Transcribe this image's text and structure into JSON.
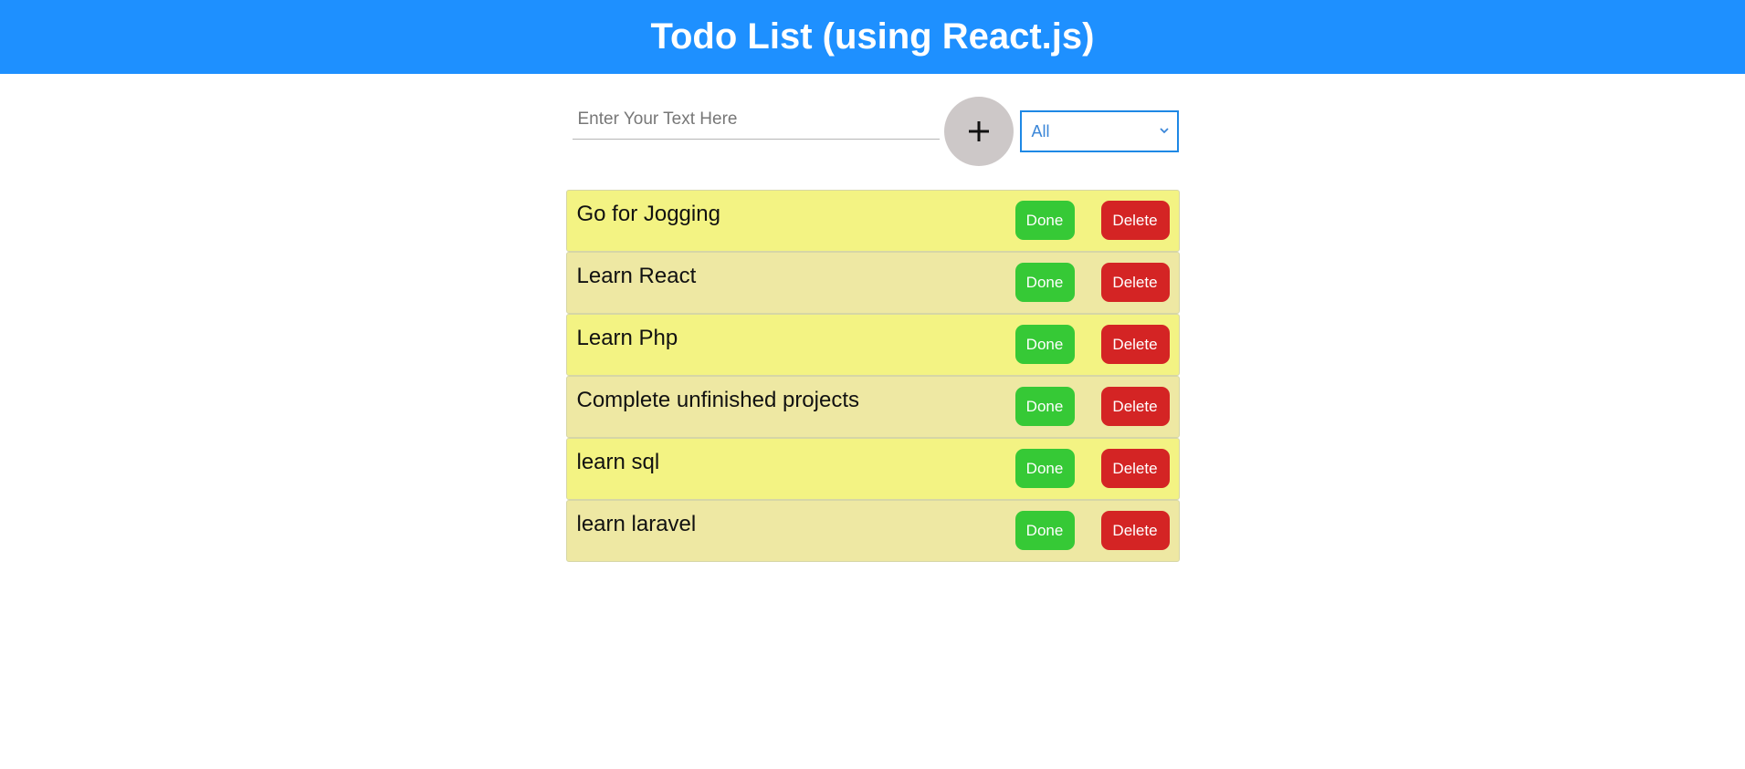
{
  "header": {
    "title": "Todo List (using React.js)"
  },
  "controls": {
    "input_placeholder": "Enter Your Text Here",
    "add_icon": "plus-icon",
    "filter_selected": "All"
  },
  "todos": [
    {
      "text": "Go for Jogging",
      "done_label": "Done",
      "delete_label": "Delete"
    },
    {
      "text": "Learn React",
      "done_label": "Done",
      "delete_label": "Delete"
    },
    {
      "text": "Learn Php",
      "done_label": "Done",
      "delete_label": "Delete"
    },
    {
      "text": "Complete unfinished projects",
      "done_label": "Done",
      "delete_label": "Delete"
    },
    {
      "text": "learn sql",
      "done_label": "Done",
      "delete_label": "Delete"
    },
    {
      "text": "learn laravel",
      "done_label": "Done",
      "delete_label": "Delete"
    }
  ],
  "colors": {
    "header_bg": "#1e90ff",
    "row_odd": "#f3f383",
    "row_even": "#eee8a3",
    "done_bg": "#36c936",
    "delete_bg": "#d42424",
    "add_btn_bg": "#cdc8c8",
    "select_border": "#1e88e5"
  }
}
